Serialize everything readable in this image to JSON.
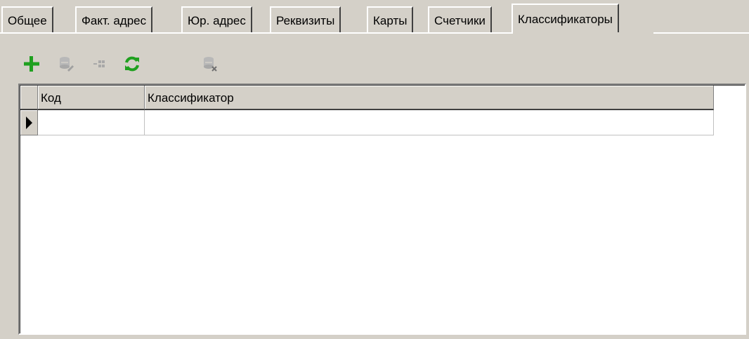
{
  "tabs": [
    {
      "label": "Общее",
      "active": false
    },
    {
      "label": "Факт. адрес",
      "active": false
    },
    {
      "label": "Юр. адрес",
      "active": false
    },
    {
      "label": "Реквизиты",
      "active": false
    },
    {
      "label": "Карты",
      "active": false
    },
    {
      "label": "Счетчики",
      "active": false
    },
    {
      "label": "Классификаторы",
      "active": true
    }
  ],
  "toolbar": {
    "buttons": [
      {
        "icon": "plus-icon",
        "enabled": true,
        "color": "#1fa01f"
      },
      {
        "icon": "edit-record-icon",
        "enabled": false
      },
      {
        "icon": "insert-row-icon",
        "enabled": false
      },
      {
        "icon": "refresh-icon",
        "enabled": true,
        "color": "#1fa01f"
      },
      {
        "icon": "delete-record-icon",
        "enabled": false
      }
    ]
  },
  "grid": {
    "columns": [
      {
        "label": "Код"
      },
      {
        "label": "Классификатор"
      }
    ],
    "rows": [
      {
        "code": "",
        "classifier": "",
        "current": true
      }
    ]
  }
}
